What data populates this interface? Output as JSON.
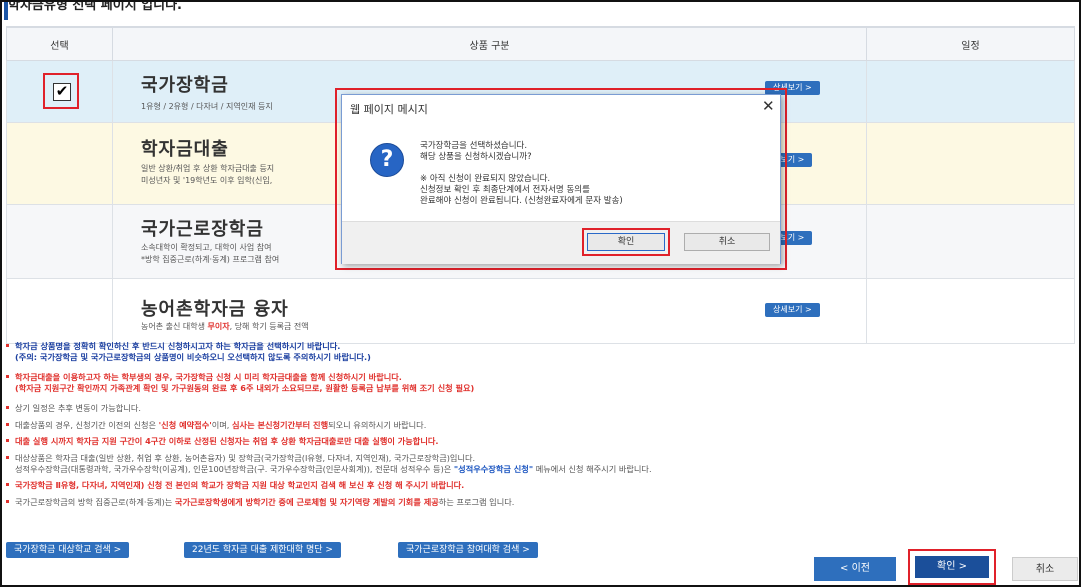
{
  "header": {
    "title": "학자금유형 선택 페이지 입니다."
  },
  "table": {
    "columns": [
      "선택",
      "상품 구분",
      "일정"
    ],
    "products": [
      {
        "name": "국가장학금",
        "desc": [
          "1유형 / 2유형 / 다자녀 / 지역인재 등지"
        ],
        "detail": "상세보기 >",
        "checked": "✔"
      },
      {
        "name": "학자금대출",
        "desc": [
          "일반 상환/취업 후 상환 학자금대출 등지",
          "미성년자 및 '19학년도 이후 입학(신입,"
        ],
        "detail": "세보기 >"
      },
      {
        "name": "국가근로장학금",
        "desc": [
          "소속대학이 확정되고, 대학이 사업 참여",
          "*방학 집중근로(하계·동계) 프로그램 참여"
        ],
        "detail": "세보기 >"
      },
      {
        "name": "농어촌학자금 융자",
        "desc_pre": "농어촌 출신 대학생 ",
        "desc_red": "무이자",
        "desc_post": ", 당해 학기 등록금 전액",
        "detail": "상세보기 >"
      }
    ]
  },
  "notes": {
    "n1a": "학자금 상품명을 정확히 확인하신 후 반드시 신청하시고자 하는 학자금을 선택하시기 바랍니다.",
    "n1b": "(주의: 국가장학금 및 국가근로장학금의 상품명이 비슷하오니 오선택하지 않도록 주의하시기 바랍니다.)",
    "n2a": "학자금대출을 이용하고자 하는 학부생의 경우, 국가장학금 신청 시 미리 학자금대출을 함께 신청하시기 바랍니다.",
    "n2b": "(학자금 지원구간 확인까지 가족관계 확인 및 가구원동의 완료 후 6주 내외가 소요되므로, 원활한 등록금 납부를 위해 조기 신청 필요)",
    "n3": "상기 일정은 추후 변동이 가능합니다.",
    "n4_pre": "대출상품의 경우, 신청기간 이전의 신청은 ",
    "n4_b1": "'신청 예약접수'",
    "n4_mid": "이며, ",
    "n4_b2": "심사는 본신청기간부터 진행",
    "n4_post": "되오니 유의하시기 바랍니다.",
    "n5": "대출 실행 시까지 학자금 지원 구간이 4구간 이하로 산정된 신청자는 취업 후 상환 학자금대출로만 대출 실행이 가능합니다.",
    "n6a": "대상상품은 학자금 대출(일반 상환, 취업 후 상환, 농어촌융자) 및 장학금(국가장학금(Ⅰ유형, 다자녀, 지역인재), 국가근로장학금)입니다.",
    "n6b_pre": "성적우수장학금(대통령과학, 국가우수장학(이공계), 인문100년장학금(구. 국가우수장학금(인문사회계)), 전문대 성적우수 등)은 ",
    "n6b_b": "\"성적우수장학금 신청\"",
    "n6b_post": " 메뉴에서 신청 해주시기 바랍니다.",
    "n7": "국가장학금 Ⅱ유형, 다자녀, 지역인재) 신청 전 본인의 학교가 장학금 지원 대상 학교인지 검색 해 보신 후 신청 해 주시기 바랍니다.",
    "n8_pre": "국가근로장학금의 방학 집중근로(하계·동계)는 ",
    "n8_r": "국가근로장학생에게 방학기간 중에 근로체험 및 자기역량 계발의 기회를 제공",
    "n8_post": "하는 프로그램 입니다."
  },
  "links": [
    "국가장학금 대상학교 검색 >",
    "22년도 학자금 대출 제한대학 명단 >",
    "국가근로장학금 참여대학 검색 >"
  ],
  "actions": {
    "prev": "< 이전",
    "ok": "확인 >",
    "cancel": "취소"
  },
  "dialog": {
    "title": "웹 페이지 메시지",
    "close": "✕",
    "icon": "?",
    "lines": [
      "국가장학금을 선택하셨습니다.",
      "해당 상품을 신청하시겠습니까?",
      "※ 아직 신청이 완료되지 않았습니다.",
      "신청정보 확인 후 최종단계에서 전자서명 동의를",
      "완료해야 신청이 완료됩니다. (신청완료자에게 문자 발송)"
    ],
    "ok": "확인",
    "cancel": "취소"
  },
  "colors": {
    "accent": "#2e6fbd",
    "highlight": "#e0212a"
  }
}
